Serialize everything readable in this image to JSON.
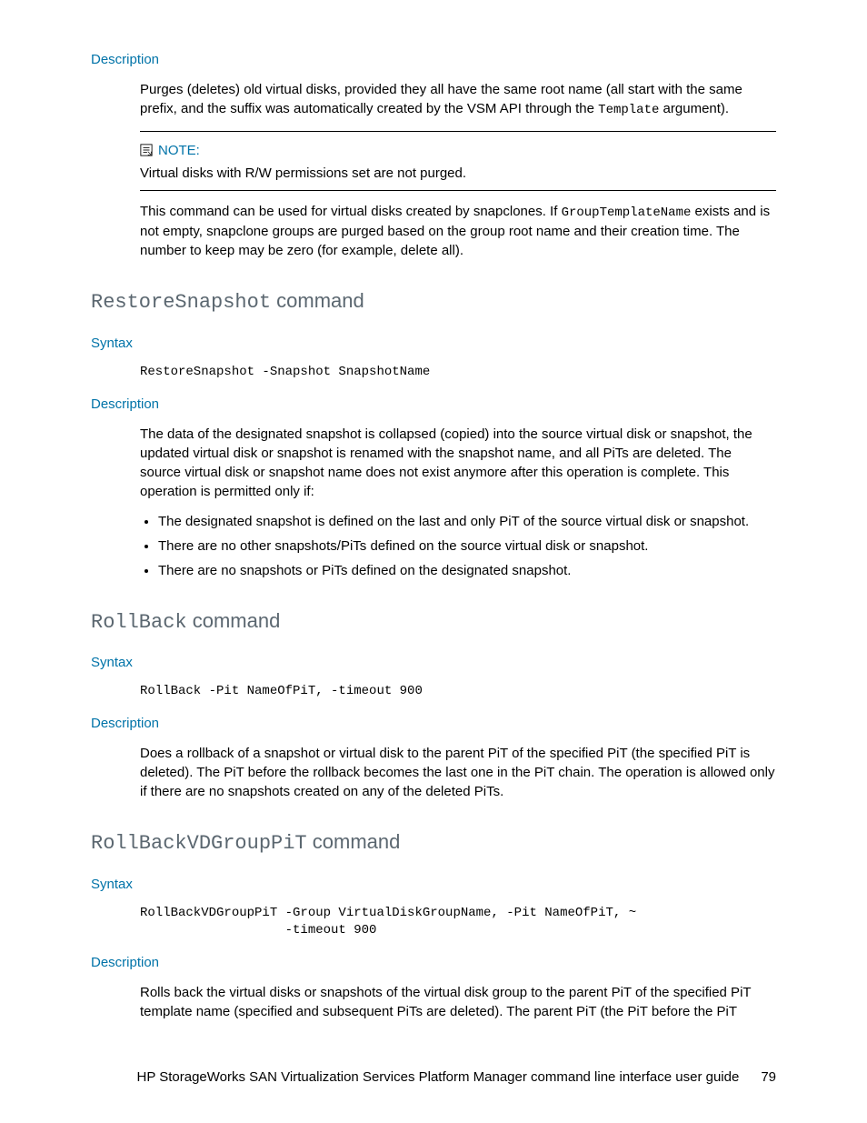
{
  "s1": {
    "desc_label": "Description",
    "p1_a": "Purges (deletes) old virtual disks, provided they all have the same root name (all start with the same prefix, and the suffix was automatically created by the VSM API through the ",
    "p1_code": "Template",
    "p1_b": " argument).",
    "note_label": "NOTE:",
    "note_text": "Virtual disks with R/W permissions set are not purged.",
    "p2_a": "This command can be used for virtual disks created by snapclones. If ",
    "p2_code": "GroupTemplateName",
    "p2_b": " exists and is not empty, snapclone groups are purged based on the group root name and their creation time. The number to keep may be zero (for example, delete all)."
  },
  "s2": {
    "h_code": "RestoreSnapshot",
    "h_rest": " command",
    "syntax_label": "Syntax",
    "code": "RestoreSnapshot -Snapshot SnapshotName",
    "desc_label": "Description",
    "p1": "The data of the designated snapshot is collapsed (copied) into the source virtual disk or snapshot, the updated virtual disk or snapshot is renamed with the snapshot name, and all PiTs are deleted. The source virtual disk or snapshot name does not exist anymore after this operation is complete. This operation is permitted only if:",
    "b1": "The designated snapshot is defined on the last and only PiT of the source virtual disk or snapshot.",
    "b2": "There are no other snapshots/PiTs defined on the source virtual disk or snapshot.",
    "b3": "There are no snapshots or PiTs defined on the designated snapshot."
  },
  "s3": {
    "h_code": "RollBack",
    "h_rest": " command",
    "syntax_label": "Syntax",
    "code": "RollBack -Pit NameOfPiT, -timeout 900",
    "desc_label": "Description",
    "p1": "Does a rollback of a snapshot or virtual disk to the parent PiT of the specified PiT (the specified PiT is deleted). The PiT before the rollback becomes the last one in the PiT chain. The operation is allowed only if there are no snapshots created on any of the deleted PiTs."
  },
  "s4": {
    "h_code": "RollBackVDGroupPiT",
    "h_rest": " command",
    "syntax_label": "Syntax",
    "code": "RollBackVDGroupPiT -Group VirtualDiskGroupName, -Pit NameOfPiT, ~\n                   -timeout 900",
    "desc_label": "Description",
    "p1": "Rolls back the virtual disks or snapshots of the virtual disk group to the parent PiT of the specified PiT template name (specified and subsequent PiTs are deleted). The parent PiT (the PiT before the PiT"
  },
  "footer": {
    "title": "HP StorageWorks SAN Virtualization Services Platform Manager command line interface user guide",
    "page": "79"
  }
}
